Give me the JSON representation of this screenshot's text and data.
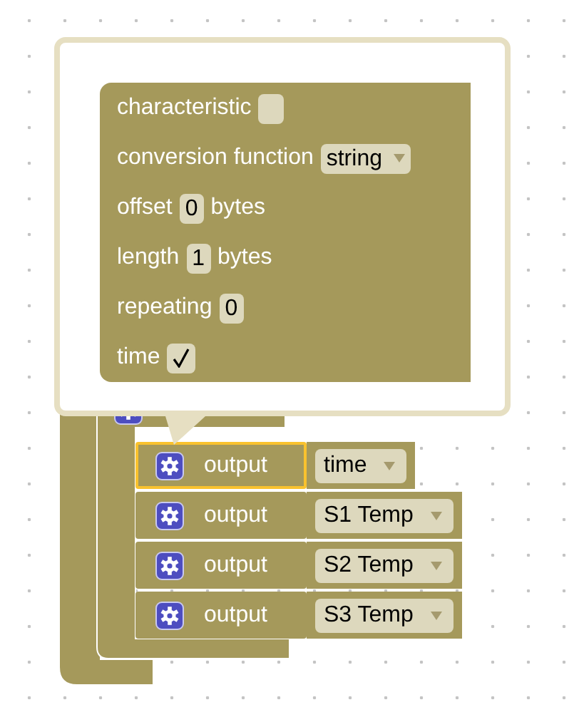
{
  "mutator_block": {
    "fields": [
      {
        "kind": "input",
        "label": "characteristic"
      },
      {
        "kind": "dropdown",
        "label": "conversion function",
        "value": "string"
      },
      {
        "kind": "number",
        "label": "offset",
        "value": "0",
        "suffix": "bytes"
      },
      {
        "kind": "number",
        "label": "length",
        "value": "1",
        "suffix": "bytes"
      },
      {
        "kind": "number",
        "label": "repeating",
        "value": "0"
      },
      {
        "kind": "checkbox",
        "label": "time",
        "checked": true
      }
    ]
  },
  "outputs": [
    {
      "label": "output",
      "selected": true,
      "value": "time"
    },
    {
      "label": "output",
      "selected": false,
      "value": "S1 Temp"
    },
    {
      "label": "output",
      "selected": false,
      "value": "S2 Temp"
    },
    {
      "label": "output",
      "selected": false,
      "value": "S3 Temp"
    }
  ]
}
